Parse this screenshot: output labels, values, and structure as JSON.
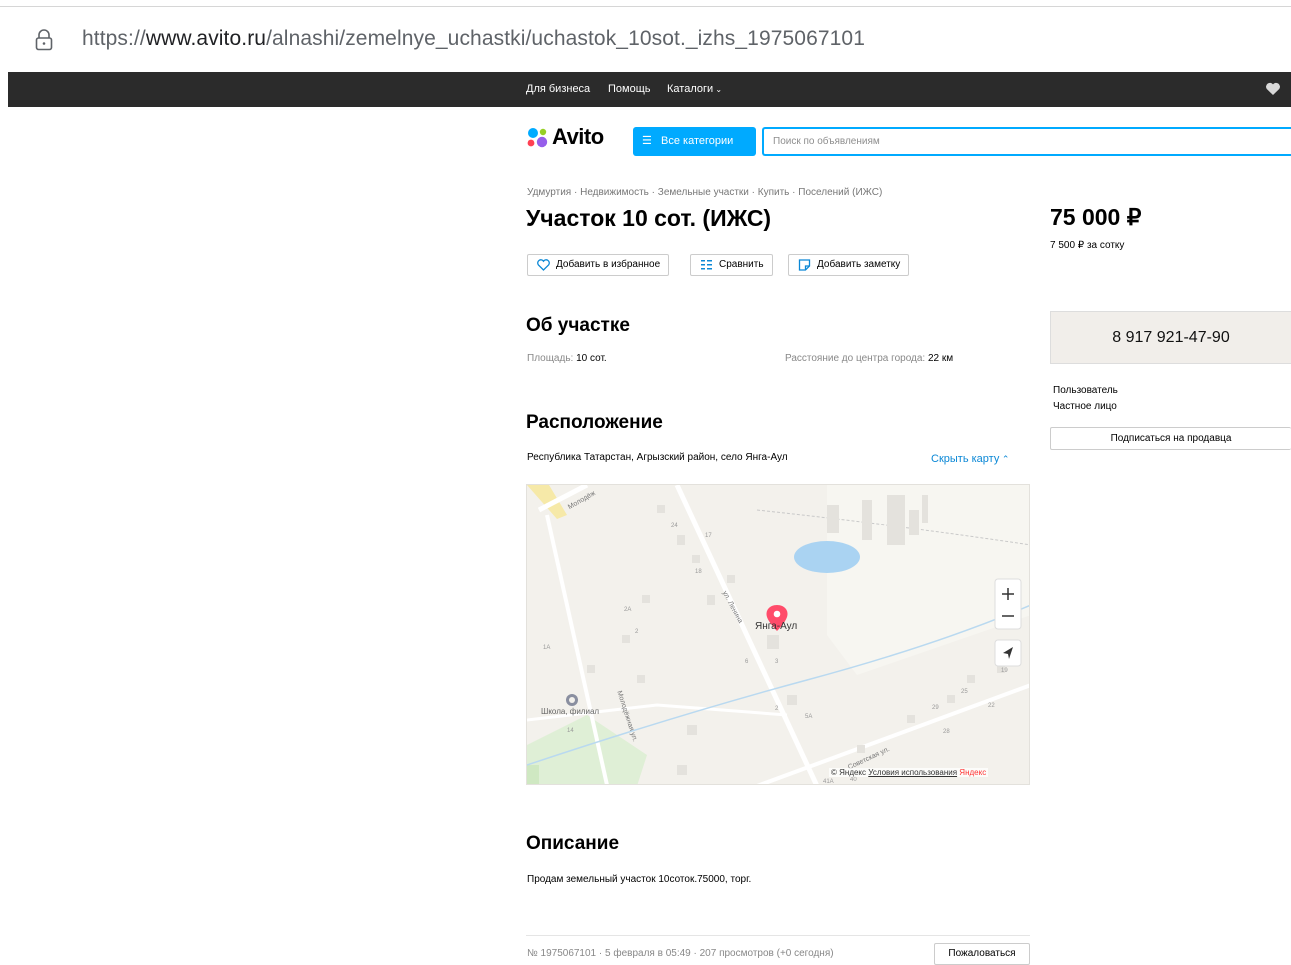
{
  "browser": {
    "url_prefix": "https://",
    "url_domain": "www.avito.ru",
    "url_path": "/alnashi/zemelnye_uchastki/uchastok_10sot._izhs_1975067101"
  },
  "topnav": {
    "items": [
      "Для бизнеса",
      "Помощь",
      "Каталоги"
    ]
  },
  "header": {
    "logo": "Avito",
    "categories_button": "Все категории",
    "search_placeholder": "Поиск по объявлениям"
  },
  "listing": {
    "breadcrumb": "Удмуртия · Недвижимость · Земельные участки · Купить · Поселений (ИЖС)",
    "title": "Участок 10 сот. (ИЖС)",
    "price": "75 000 ₽",
    "price_per": "7 500 ₽ за сотку",
    "actions": {
      "favorite": "Добавить в избранное",
      "compare": "Сравнить",
      "note": "Добавить заметку"
    }
  },
  "about": {
    "heading": "Об участке",
    "area_label": "Площадь:",
    "area_value": "10 сот.",
    "distance_label": "Расстояние до центра города:",
    "distance_value": "22 км"
  },
  "seller": {
    "phone": "8 917 921-47-90",
    "name": "Пользователь",
    "type": "Частное лицо",
    "subscribe": "Подписаться на продавца"
  },
  "location": {
    "heading": "Расположение",
    "address": "Республика Татарстан, Агрызский район, село Янга-Аул",
    "hide_map": "Скрыть карту",
    "map": {
      "place_label": "Янга-Аул",
      "school_label": "Школа, филиал",
      "street_1": "Молодёжная ул.",
      "street_2": "ул. Ленина",
      "street_3": "Советская ул.",
      "street_top": "Молодёж",
      "copyright": "© Яндекс",
      "terms": "Условия использования",
      "brand": "Яндекс",
      "house_numbers": [
        "24",
        "17",
        "18",
        "2А",
        "2",
        "1А",
        "6",
        "3",
        "2",
        "5А",
        "14",
        "25",
        "29",
        "22",
        "28",
        "19",
        "41А",
        "40"
      ]
    }
  },
  "description": {
    "heading": "Описание",
    "text": "Продам земельный участок 10соток.75000, торг."
  },
  "footer": {
    "meta": "№ 1975067101 · 5 февраля в 05:49 · 207 просмотров (+0 сегодня)",
    "report": "Пожаловаться"
  }
}
